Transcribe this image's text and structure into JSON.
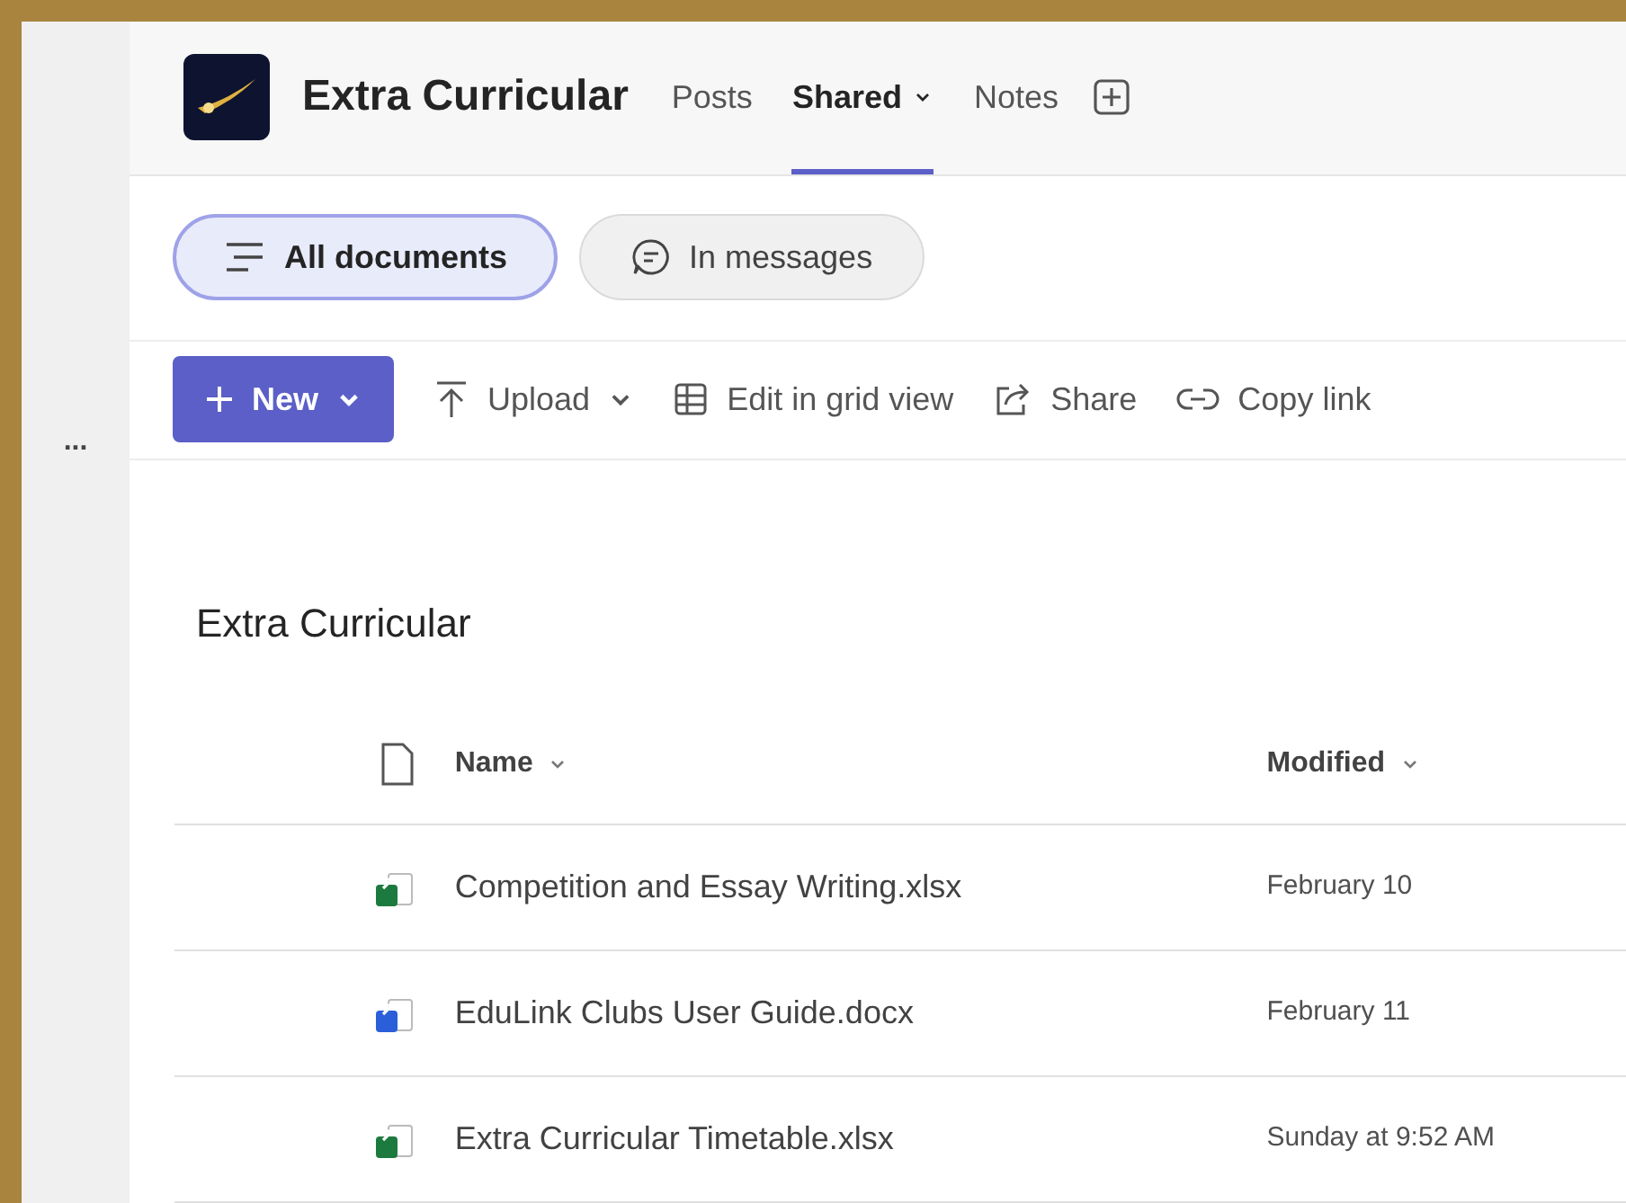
{
  "channel": {
    "name": "Extra Curricular"
  },
  "tabs": [
    {
      "label": "Posts",
      "selected": false,
      "dropdown": false
    },
    {
      "label": "Shared",
      "selected": true,
      "dropdown": true
    },
    {
      "label": "Notes",
      "selected": false,
      "dropdown": false
    }
  ],
  "filters": [
    {
      "label": "All documents",
      "selected": true,
      "kind": "list"
    },
    {
      "label": "In messages",
      "selected": false,
      "kind": "chat"
    }
  ],
  "toolbar": [
    {
      "label": "New",
      "kind": "new"
    },
    {
      "label": "Upload",
      "kind": "upload"
    },
    {
      "label": "Edit in grid view",
      "kind": "grid"
    },
    {
      "label": "Share",
      "kind": "share"
    },
    {
      "label": "Copy link",
      "kind": "link"
    }
  ],
  "rail": {
    "more": "..."
  },
  "library": {
    "title": "Extra Curricular",
    "columns": [
      "Name",
      "Modified"
    ],
    "rows": [
      {
        "name": "Competition and Essay Writing.xlsx",
        "modified": "February 10",
        "kind": "xlsx"
      },
      {
        "name": "EduLink Clubs User Guide.docx",
        "modified": "February 11",
        "kind": "docx"
      },
      {
        "name": "Extra Curricular Timetable.xlsx",
        "modified": "Sunday at 9:52 AM",
        "kind": "xlsx"
      }
    ]
  }
}
